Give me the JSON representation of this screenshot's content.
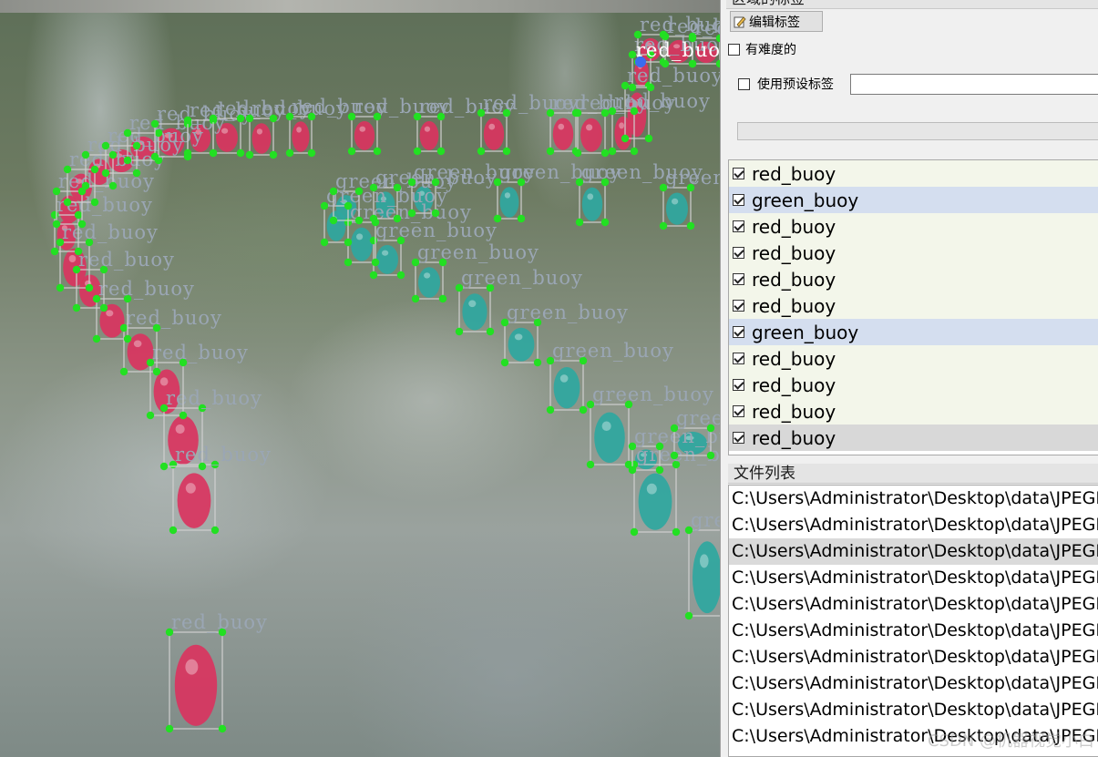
{
  "panel": {
    "region_header": "区域的标签",
    "edit_label_button": "编辑标签",
    "difficult_label": "有难度的",
    "difficult_checked": false,
    "use_preset_label": "使用预设标签",
    "use_preset_checked": false,
    "preset_input_value": ""
  },
  "label_list": {
    "items": [
      {
        "label": "red_buoy",
        "checked": true,
        "state": "normal"
      },
      {
        "label": "green_buoy",
        "checked": true,
        "state": "highlighted"
      },
      {
        "label": "red_buoy",
        "checked": true,
        "state": "normal"
      },
      {
        "label": "red_buoy",
        "checked": true,
        "state": "normal"
      },
      {
        "label": "red_buoy",
        "checked": true,
        "state": "normal"
      },
      {
        "label": "red_buoy",
        "checked": true,
        "state": "normal"
      },
      {
        "label": "green_buoy",
        "checked": true,
        "state": "highlighted"
      },
      {
        "label": "red_buoy",
        "checked": true,
        "state": "normal"
      },
      {
        "label": "red_buoy",
        "checked": true,
        "state": "normal"
      },
      {
        "label": "red_buoy",
        "checked": true,
        "state": "normal"
      },
      {
        "label": "red_buoy",
        "checked": true,
        "state": "selected"
      }
    ]
  },
  "file_list": {
    "header": "文件列表",
    "items": [
      {
        "path": "C:\\Users\\Administrator\\Desktop\\data\\JPEGImages",
        "selected": false
      },
      {
        "path": "C:\\Users\\Administrator\\Desktop\\data\\JPEGImages",
        "selected": false
      },
      {
        "path": "C:\\Users\\Administrator\\Desktop\\data\\JPEGImages",
        "selected": true
      },
      {
        "path": "C:\\Users\\Administrator\\Desktop\\data\\JPEGImages",
        "selected": false
      },
      {
        "path": "C:\\Users\\Administrator\\Desktop\\data\\JPEGImages",
        "selected": false
      },
      {
        "path": "C:\\Users\\Administrator\\Desktop\\data\\JPEGImages",
        "selected": false
      },
      {
        "path": "C:\\Users\\Administrator\\Desktop\\data\\JPEGImages",
        "selected": false
      },
      {
        "path": "C:\\Users\\Administrator\\Desktop\\data\\JPEGImages",
        "selected": false
      },
      {
        "path": "C:\\Users\\Administrator\\Desktop\\data\\JPEGImages",
        "selected": false
      },
      {
        "path": "C:\\Users\\Administrator\\Desktop\\data\\JPEGImages",
        "selected": false
      }
    ]
  },
  "watermark": "CSDN @机器视觉小白",
  "annotations": {
    "red_label": "red_buoy",
    "green_label": "green_buoy",
    "red_box_count": 30,
    "green_box_count": 18
  },
  "colors": {
    "handle": "#22e022",
    "label_text": "#9aa6b4",
    "red_buoy": "#d9345f",
    "green_buoy": "#2fa7a0",
    "row_highlight": "#d4deef",
    "row_normal": "#f3f6ea",
    "row_selected": "#d8d8d8"
  }
}
